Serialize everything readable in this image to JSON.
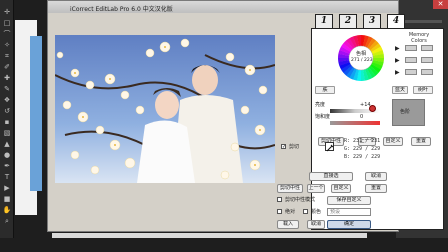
{
  "app": {
    "title": "iCorrect EditLab Pro 6.0 中文汉化版",
    "close_glyph": "✕"
  },
  "photoshop": {
    "tool_icons": [
      "move-icon",
      "marquee-icon",
      "lasso-icon",
      "magic-wand-icon",
      "crop-icon",
      "eyedropper-icon",
      "healing-icon",
      "brush-icon",
      "stamp-icon",
      "history-brush-icon",
      "eraser-icon",
      "gradient-icon",
      "blur-icon",
      "dodge-icon",
      "pen-icon",
      "type-icon",
      "path-select-icon",
      "shape-icon",
      "hand-icon",
      "zoom-icon"
    ],
    "tool_glyphs": [
      "✛",
      "□",
      "⌒",
      "✧",
      "⌗",
      "✐",
      "✚",
      "✎",
      "❖",
      "↺",
      "▪",
      "▧",
      "▲",
      "●",
      "✒",
      "T",
      "▶",
      "■",
      "✋",
      "⌕"
    ]
  },
  "tabs": [
    {
      "label": "1",
      "name": "tab-1"
    },
    {
      "label": "2",
      "name": "tab-2"
    },
    {
      "label": "3",
      "name": "tab-3"
    },
    {
      "label": "4",
      "name": "tab-4"
    }
  ],
  "wheel": {
    "center_label": "色相",
    "center_value": "271 / 223"
  },
  "memory": {
    "label": "Memory Colors",
    "rows": 3
  },
  "buttons": {
    "skin": "肤",
    "sky": "蓝天",
    "foliage": "树叶",
    "previous_top": "上一",
    "custom_top": "自定义",
    "reset_top": "重置",
    "neutral": "中性色",
    "neutral_hint": "色彩",
    "clip_neutral": "剪切中性",
    "previous_mid": "上一个",
    "custom_mid": "自定义",
    "reset_mid": "重置",
    "direct_select": "直接选",
    "cancel_mid": "取消",
    "clip_neutral_2": "剪切中性",
    "previous_low": "上一个",
    "custom_low": "自定义",
    "reset_low": "重置",
    "save_custom": "保存自定义",
    "load": "载入",
    "cancel": "取消",
    "ok": "确定"
  },
  "sliders": {
    "brightness_label": "亮度",
    "brightness_value": "+14",
    "saturation_label": "饱和度",
    "saturation_value": "0",
    "preview_label": "色阶"
  },
  "readout": {
    "row1": "R: 231  /  231",
    "row2": "G: 229  /  229",
    "row3": "B: 229  /  229"
  },
  "checks": {
    "clip": "剪切",
    "clip_mode": "剪切中性模式",
    "relative": "绝对",
    "absolute": "颜色"
  },
  "inputs": {
    "amount": "0",
    "preset": "预设"
  },
  "colors": {
    "dialog_bg": "#d4d0c8",
    "panel_bg": "#ffffff",
    "ok_accent": "#cfd9e8",
    "photoshop_bg": "#1e1e1e"
  }
}
